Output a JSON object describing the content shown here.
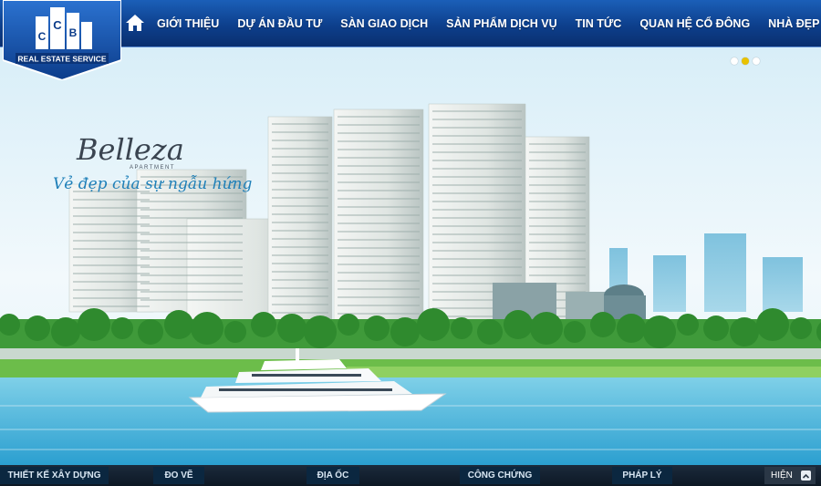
{
  "logo": {
    "letters": "CCB",
    "caption": "REAL ESTATE SERVICE"
  },
  "nav": {
    "home_icon": "home-icon",
    "items": [
      {
        "label": "GIỚI THIỆU"
      },
      {
        "label": "DỰ ÁN ĐẦU TƯ"
      },
      {
        "label": "SÀN GIAO DỊCH"
      },
      {
        "label": "SẢN PHẨM DỊCH VỤ"
      },
      {
        "label": "TIN TỨC"
      },
      {
        "label": "QUAN HỆ CỔ ĐÔNG"
      },
      {
        "label": "NHÀ ĐẸP"
      }
    ]
  },
  "slider": {
    "dots": 3,
    "active_index": 1
  },
  "hero": {
    "brand": "Belleza",
    "brand_sub": "APARTMENT",
    "slogan": "Vẻ đẹp của sự ngẫu hứng"
  },
  "bottom_bar": {
    "links": [
      {
        "label": "THIẾT KẾ XÂY DỰNG"
      },
      {
        "label": "ĐO VẼ"
      },
      {
        "label": "ĐỊA ỐC"
      },
      {
        "label": "CÔNG CHỨNG"
      },
      {
        "label": "PHÁP LÝ"
      }
    ],
    "show_label": "HIỆN",
    "show_icon": "chevron-up-icon"
  },
  "colors": {
    "nav_blue": "#0d3f8c",
    "accent_yellow": "#e9c200",
    "slogan_blue": "#1e7fb8"
  }
}
